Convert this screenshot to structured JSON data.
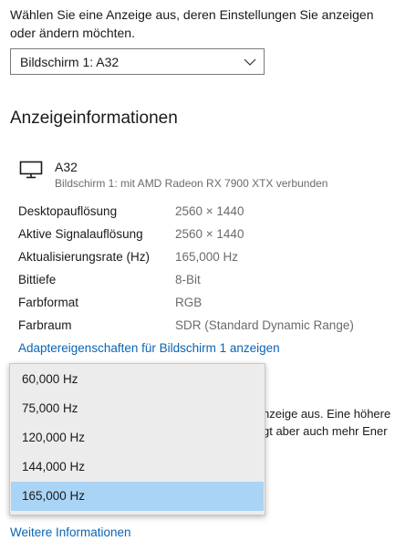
{
  "intro_text": "Wählen Sie eine Anzeige aus, deren Einstellungen Sie anzeigen oder ändern möchten.",
  "display_select": {
    "value": "Bildschirm 1: A32",
    "icon": "chevron-down-icon"
  },
  "section_title": "Anzeigeinformationen",
  "monitor": {
    "icon": "monitor-icon",
    "name": "A32",
    "subtitle": "Bildschirm 1: mit AMD Radeon RX 7900 XTX verbunden"
  },
  "info_rows": [
    {
      "label": "Desktopauflösung",
      "value": "2560 × 1440"
    },
    {
      "label": "Aktive Signalauflösung",
      "value": "2560 × 1440"
    },
    {
      "label": "Aktualisierungsrate (Hz)",
      "value": "165,000 Hz"
    },
    {
      "label": "Bittiefe",
      "value": "8-Bit"
    },
    {
      "label": "Farbformat",
      "value": "RGB"
    },
    {
      "label": "Farbraum",
      "value": "SDR (Standard Dynamic Range)"
    }
  ],
  "adapter_link": "Adaptereigenschaften für Bildschirm 1 anzeigen",
  "background_text": {
    "line1": "nzeige aus. Eine höhere",
    "line2": "gt aber auch mehr Ener"
  },
  "more_info_link": "Weitere Informationen",
  "refresh_dropdown": {
    "options": [
      "60,000 Hz",
      "75,000 Hz",
      "120,000 Hz",
      "144,000 Hz",
      "165,000 Hz"
    ],
    "selected_index": 4,
    "selected_color": "#a9d4f5"
  },
  "colors": {
    "link": "#0a64b4",
    "secondary_text": "#6b6b6b",
    "dropdown_bg": "#ececec"
  }
}
